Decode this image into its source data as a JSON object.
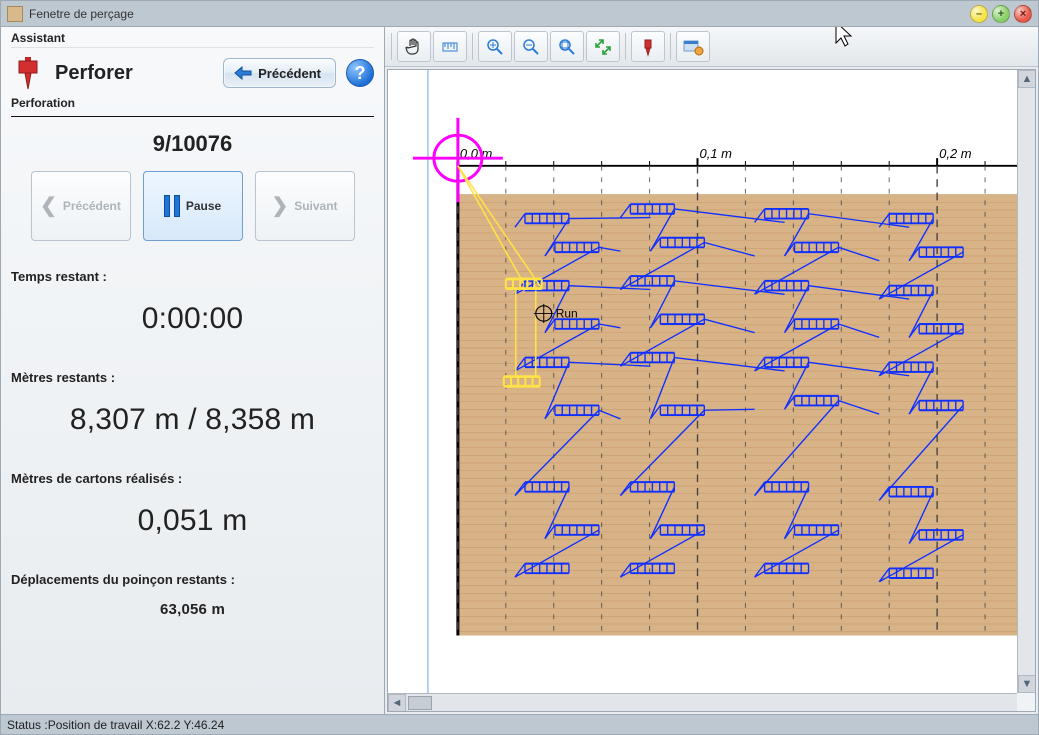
{
  "window": {
    "title": "Fenetre de perçage"
  },
  "sidebar": {
    "assistant_label": "Assistant",
    "title": "Perforer",
    "subtitle": "Perforation",
    "back_button": "Précédent",
    "counter": "9/10076",
    "nav": {
      "prev": "Précédent",
      "pause": "Pause",
      "next": "Suivant"
    },
    "metrics": {
      "time_label": "Temps restant :",
      "time_value": "0:00:00",
      "meters_label": "Mètres restants :",
      "meters_value": "8,307 m  /  8,358 m",
      "cartons_label": "Mètres de cartons réalisés :",
      "cartons_value": "0,051 m",
      "punch_label": "Déplacements du poinçon restants :",
      "punch_value": "63,056 m"
    }
  },
  "canvas": {
    "ruler": {
      "tick0": "0,0 m",
      "tick1": "0,1 m",
      "tick2": "0,2 m"
    },
    "run_label": "Run",
    "colors": {
      "screen": "#d9b388",
      "crosshair": "#ff00ff",
      "path": "#ffe246",
      "notes": "#1030ff",
      "grid": "#444444",
      "axis_v": "#6aa5e6"
    }
  },
  "status": {
    "text": "Status :Position de travail X:62.2  Y:46.24"
  },
  "toolbar": {
    "items": [
      {
        "name": "pan-hand-icon"
      },
      {
        "name": "measure-icon"
      },
      {
        "name": "zoom-in-icon"
      },
      {
        "name": "zoom-out-icon"
      },
      {
        "name": "zoom-fit-icon"
      },
      {
        "name": "resize-icon"
      },
      {
        "name": "punch-marker-icon"
      },
      {
        "name": "options-icon"
      }
    ]
  }
}
